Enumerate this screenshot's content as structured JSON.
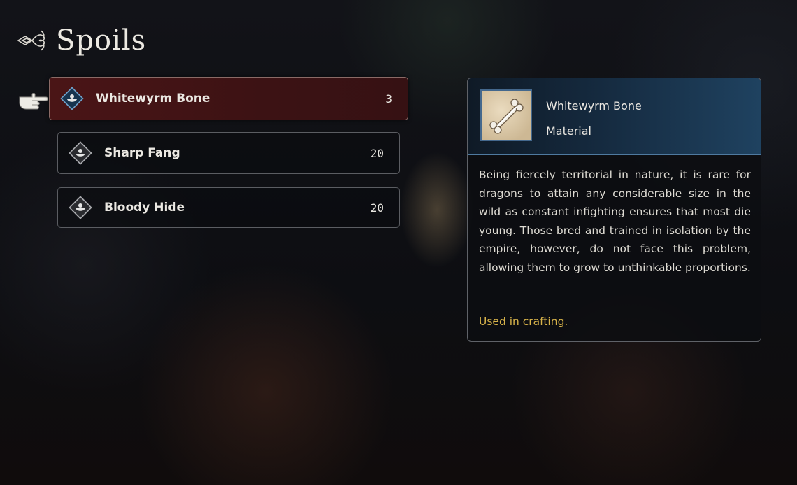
{
  "header": {
    "title": "Spoils",
    "ornament_icon": "flourish-ornament-icon"
  },
  "cursor": {
    "icon": "pointing-hand-icon"
  },
  "items": [
    {
      "name": "Whitewyrm Bone",
      "count": "3",
      "icon": "material-drop-icon",
      "selected": true
    },
    {
      "name": "Sharp Fang",
      "count": "20",
      "icon": "material-drop-icon",
      "selected": false
    },
    {
      "name": "Bloody Hide",
      "count": "20",
      "icon": "material-drop-icon",
      "selected": false
    }
  ],
  "detail": {
    "name": "Whitewyrm Bone",
    "type": "Material",
    "image_icon": "bone-icon",
    "description": "Being fiercely territorial in nature, it is rare for dragons to attain any considerable size in the wild as constant infighting ensures that most die young. Those bred and trained in isolation by the empire, however, do not face this problem, allowing them to grow to unthinkable proportions.",
    "usage": "Used in crafting."
  },
  "colors": {
    "selected_bg": "#4a1516",
    "detail_header": "#1f4260",
    "usage_text": "#d8b34a"
  }
}
